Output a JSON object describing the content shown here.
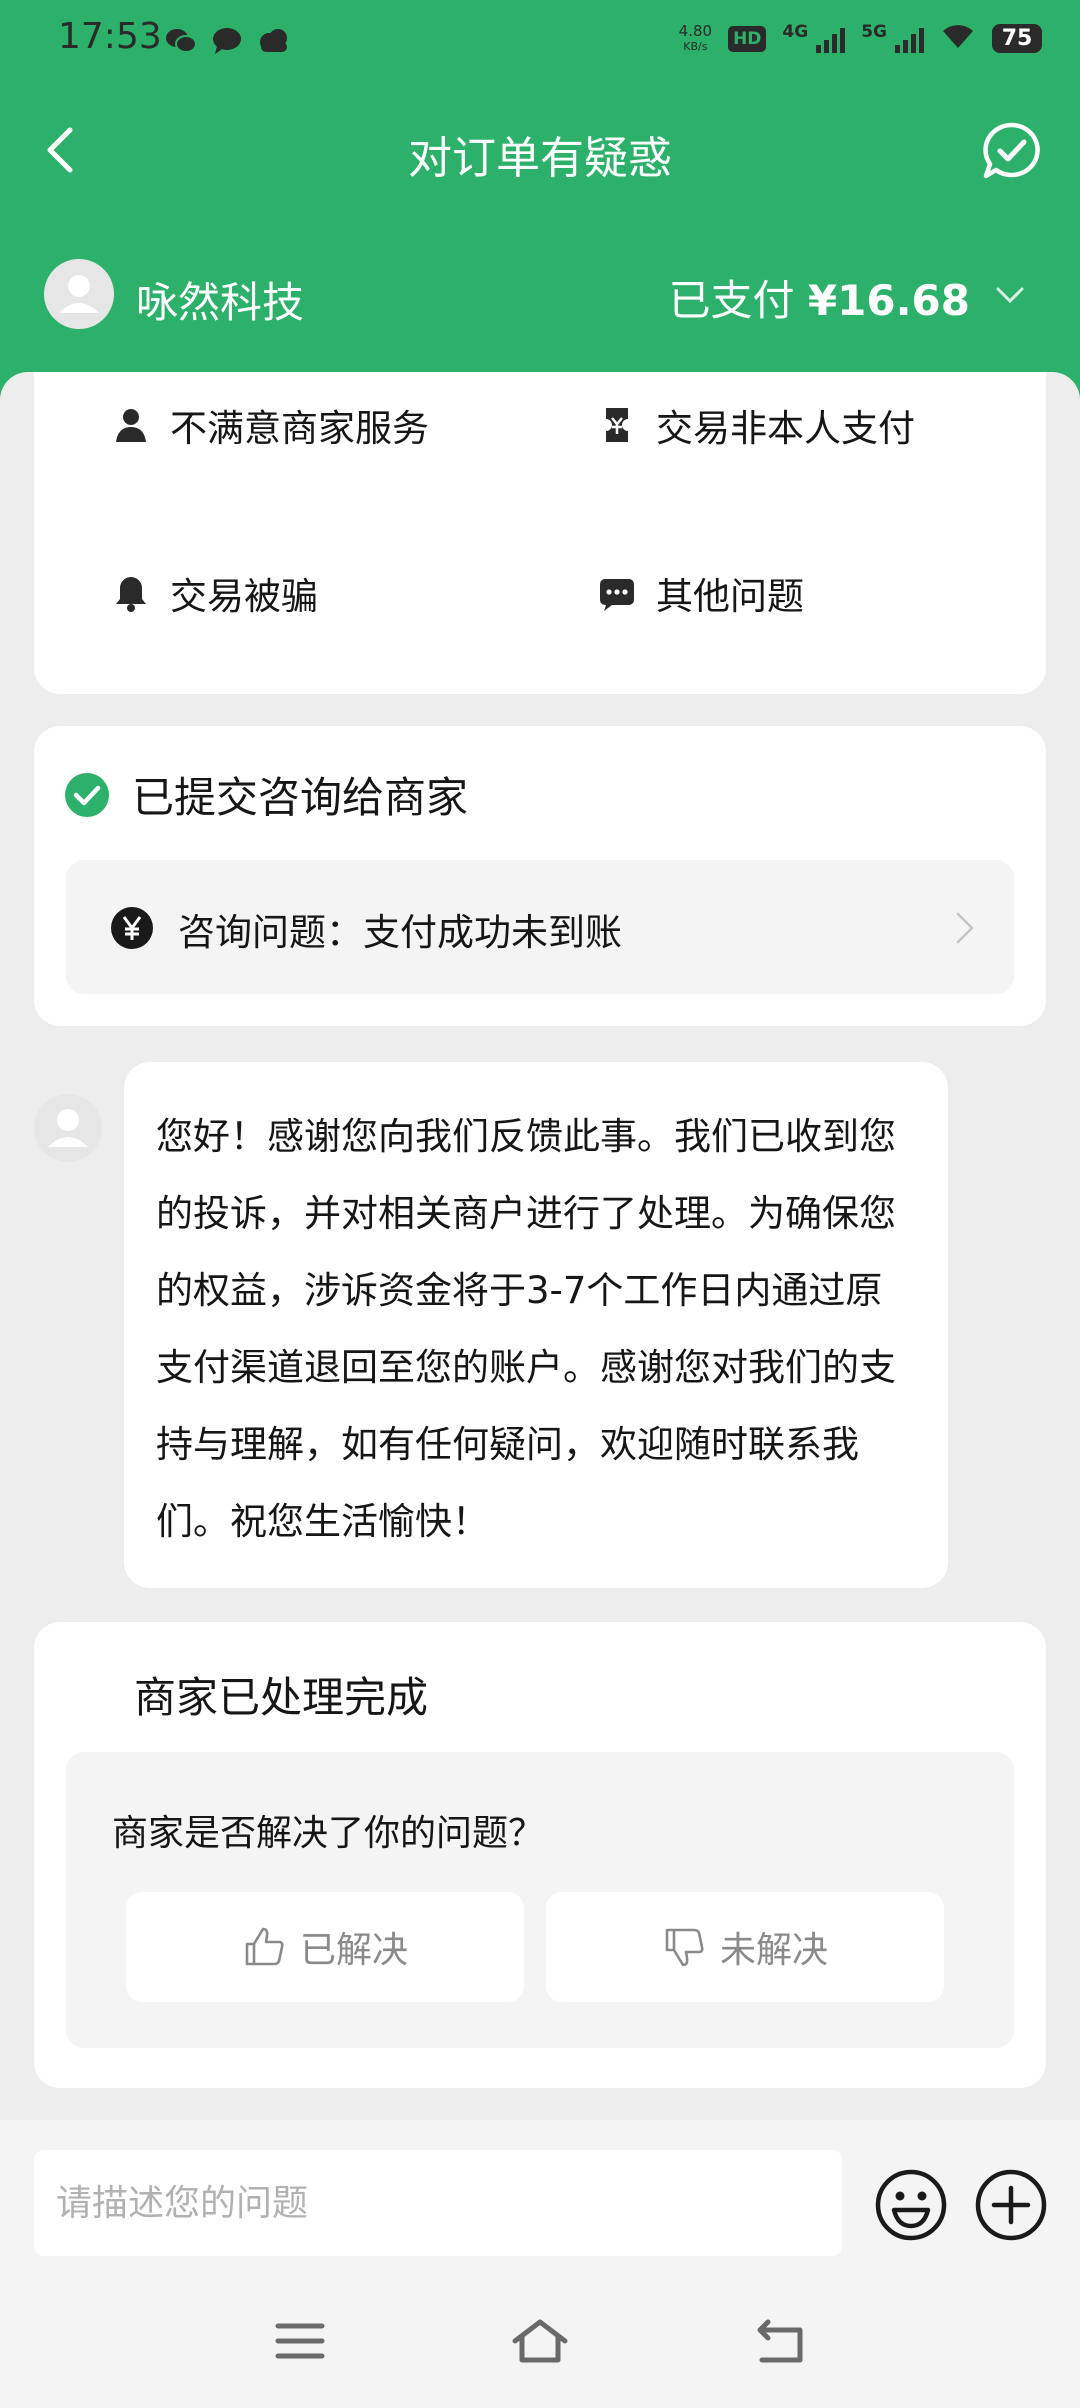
{
  "status_bar": {
    "time": "17:53",
    "net_speed_value": "4.80",
    "net_speed_unit": "KB/s",
    "hd_label": "HD",
    "sim1_label": "4G",
    "sim2_label": "5G",
    "battery": "75"
  },
  "header": {
    "title": "对订单有疑惑"
  },
  "merchant": {
    "name": "咏然科技",
    "paid_label": "已支付",
    "amount": "¥16.68"
  },
  "issue_options": [
    {
      "label": "不满意商家服务",
      "icon": "person-icon"
    },
    {
      "label": "交易非本人支付",
      "icon": "ticket-icon"
    },
    {
      "label": "交易被骗",
      "icon": "bell-icon"
    },
    {
      "label": "其他问题",
      "icon": "chat-dots-icon"
    }
  ],
  "submitted": {
    "title": "已提交咨询给商家",
    "consult_label": "咨询问题：支付成功未到账"
  },
  "message": {
    "text": "您好！感谢您向我们反馈此事。我们已收到您的投诉，并对相关商户进行了处理。为确保您的权益，涉诉资金将于3-7个工作日内通过原支付渠道退回至您的账户。感谢您对我们的支持与理解，如有任何疑问，欢迎随时联系我们。祝您生活愉快！"
  },
  "resolution": {
    "title": "商家已处理完成",
    "question": "商家是否解决了你的问题？",
    "resolved_label": "已解决",
    "unresolved_label": "未解决"
  },
  "input": {
    "placeholder": "请描述您的问题"
  },
  "colors": {
    "brand_green": "#2db16a",
    "background": "#ededed"
  }
}
